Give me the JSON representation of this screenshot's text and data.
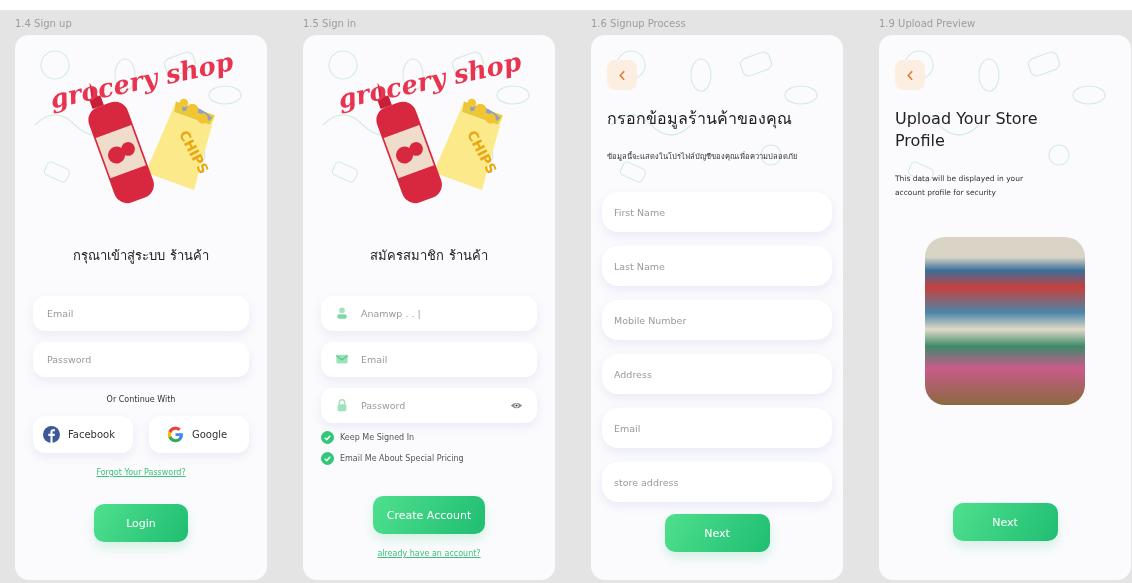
{
  "screens": [
    {
      "kind": "auth",
      "label": "1.4 Sign up",
      "items": [
        {
          "kind": "illustration",
          "logo_text": "grocery shop",
          "package_text": "CHIPS"
        },
        {
          "kind": "heading",
          "text": "กรุณาเข้าสู่ระบบ ร้านค้า"
        },
        {
          "kind": "field",
          "placeholder": "Email"
        },
        {
          "kind": "field",
          "placeholder": "Password"
        },
        {
          "kind": "note",
          "text": "Or Continue With"
        },
        {
          "kind": "social",
          "buttons": [
            {
              "kind": "facebook",
              "label": "Facebook"
            },
            {
              "kind": "google",
              "label": "Google"
            }
          ]
        },
        {
          "kind": "link",
          "text": "Forgot Your Password?"
        },
        {
          "kind": "button",
          "text": "Login"
        }
      ]
    },
    {
      "kind": "auth",
      "label": "1.5 Sign in",
      "items": [
        {
          "kind": "illustration",
          "logo_text": "grocery shop",
          "package_text": "CHIPS"
        },
        {
          "kind": "heading",
          "text": "สมัครสมาชิก ร้านค้า"
        },
        {
          "kind": "icon_field",
          "placeholder": "Anamwp . . |"
        },
        {
          "kind": "icon_field",
          "placeholder": "Email"
        },
        {
          "kind": "icon_field",
          "placeholder": "Password",
          "reveal": true
        },
        {
          "kind": "checkbox",
          "text": "Keep Me Signed In",
          "checked": true
        },
        {
          "kind": "checkbox",
          "text": "Email Me About Special Pricing",
          "checked": true
        },
        {
          "kind": "button",
          "text": "Create Account"
        },
        {
          "kind": "link",
          "text": "already have an account?"
        }
      ]
    },
    {
      "kind": "form",
      "label": "1.6 Signup Process",
      "items": [
        {
          "kind": "back"
        },
        {
          "kind": "heading",
          "text": "กรอกข้อมูลร้านค้าของคุณ"
        },
        {
          "kind": "note",
          "text": "ข้อมูลนี้จะแสดงในโปรไฟล์บัญชีของคุณเพื่อความปลอดภัย"
        },
        {
          "kind": "field",
          "placeholder": "First Name"
        },
        {
          "kind": "field",
          "placeholder": "Last Name"
        },
        {
          "kind": "field",
          "placeholder": "Mobile Number"
        },
        {
          "kind": "field",
          "placeholder": "Address"
        },
        {
          "kind": "field",
          "placeholder": "Email"
        },
        {
          "kind": "field",
          "placeholder": "store address"
        },
        {
          "kind": "button",
          "text": "Next"
        }
      ]
    },
    {
      "kind": "form",
      "label": "1.9 Upload Preview",
      "items": [
        {
          "kind": "back"
        },
        {
          "kind": "heading",
          "text": "Upload Your Store Profile"
        },
        {
          "kind": "note",
          "text": "This data will be displayed in your account profile for security"
        },
        {
          "kind": "photo"
        },
        {
          "kind": "button",
          "text": "Next"
        }
      ]
    }
  ]
}
